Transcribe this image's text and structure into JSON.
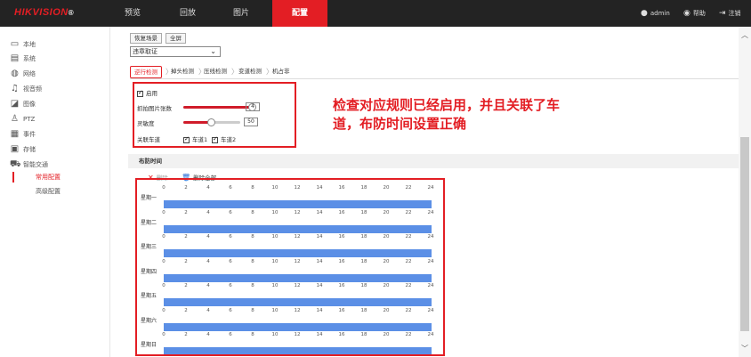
{
  "header": {
    "logo": "HIKVISION",
    "logo_mark": "®",
    "nav": [
      "预览",
      "回放",
      "图片",
      "配置"
    ],
    "active_nav": "配置",
    "user": "admin",
    "help": "帮助",
    "logout": "注销"
  },
  "sidebar": {
    "items": [
      {
        "label": "本地",
        "icon": "monitor-icon"
      },
      {
        "label": "系统",
        "icon": "system-icon"
      },
      {
        "label": "网络",
        "icon": "network-icon"
      },
      {
        "label": "视音频",
        "icon": "audio-video-icon"
      },
      {
        "label": "图像",
        "icon": "image-icon"
      },
      {
        "label": "PTZ",
        "icon": "ptz-icon"
      },
      {
        "label": "事件",
        "icon": "event-icon"
      },
      {
        "label": "存储",
        "icon": "storage-icon"
      },
      {
        "label": "智能交通",
        "icon": "smart-traffic-icon"
      }
    ],
    "sub_items": [
      {
        "label": "常用配置",
        "active": true
      },
      {
        "label": "高级配置",
        "active": false
      }
    ]
  },
  "toolbar": {
    "restore_label": "恢复场景",
    "fullscreen_label": "全屏"
  },
  "scene_select": {
    "value": "违章取证"
  },
  "tabs": [
    {
      "label": "逆行检测",
      "active": true
    },
    {
      "label": "掉头检测",
      "active": false
    },
    {
      "label": "压线检测",
      "active": false
    },
    {
      "label": "变道检测",
      "active": false
    },
    {
      "label": "机占非",
      "active": false
    }
  ],
  "settings": {
    "enable_label": "启用",
    "capture_count_label": "抓拍图片张数",
    "capture_count_value": "4",
    "capture_count_fraction": 0.95,
    "sensitivity_label": "灵敏度",
    "sensitivity_value": "50",
    "sensitivity_fraction": 0.5,
    "lanes_label": "关联车道",
    "lane1": "车道1",
    "lane2": "车道2"
  },
  "annotation": {
    "line1": "检查对应规则已经启用，并且关联了车",
    "line2": "道，布防时间设置正确"
  },
  "schedule": {
    "title": "布防时间",
    "delete_label": "删除",
    "delete_all_label": "删除全部",
    "ticks": [
      "0",
      "2",
      "4",
      "6",
      "8",
      "10",
      "12",
      "14",
      "16",
      "18",
      "20",
      "22",
      "24"
    ],
    "days": [
      "星期一",
      "星期二",
      "星期三",
      "星期四",
      "星期五",
      "星期六",
      "星期日"
    ]
  },
  "colors": {
    "brand_red": "#e31e24",
    "bar_blue": "#5b8fe6",
    "topbar": "#232323"
  }
}
